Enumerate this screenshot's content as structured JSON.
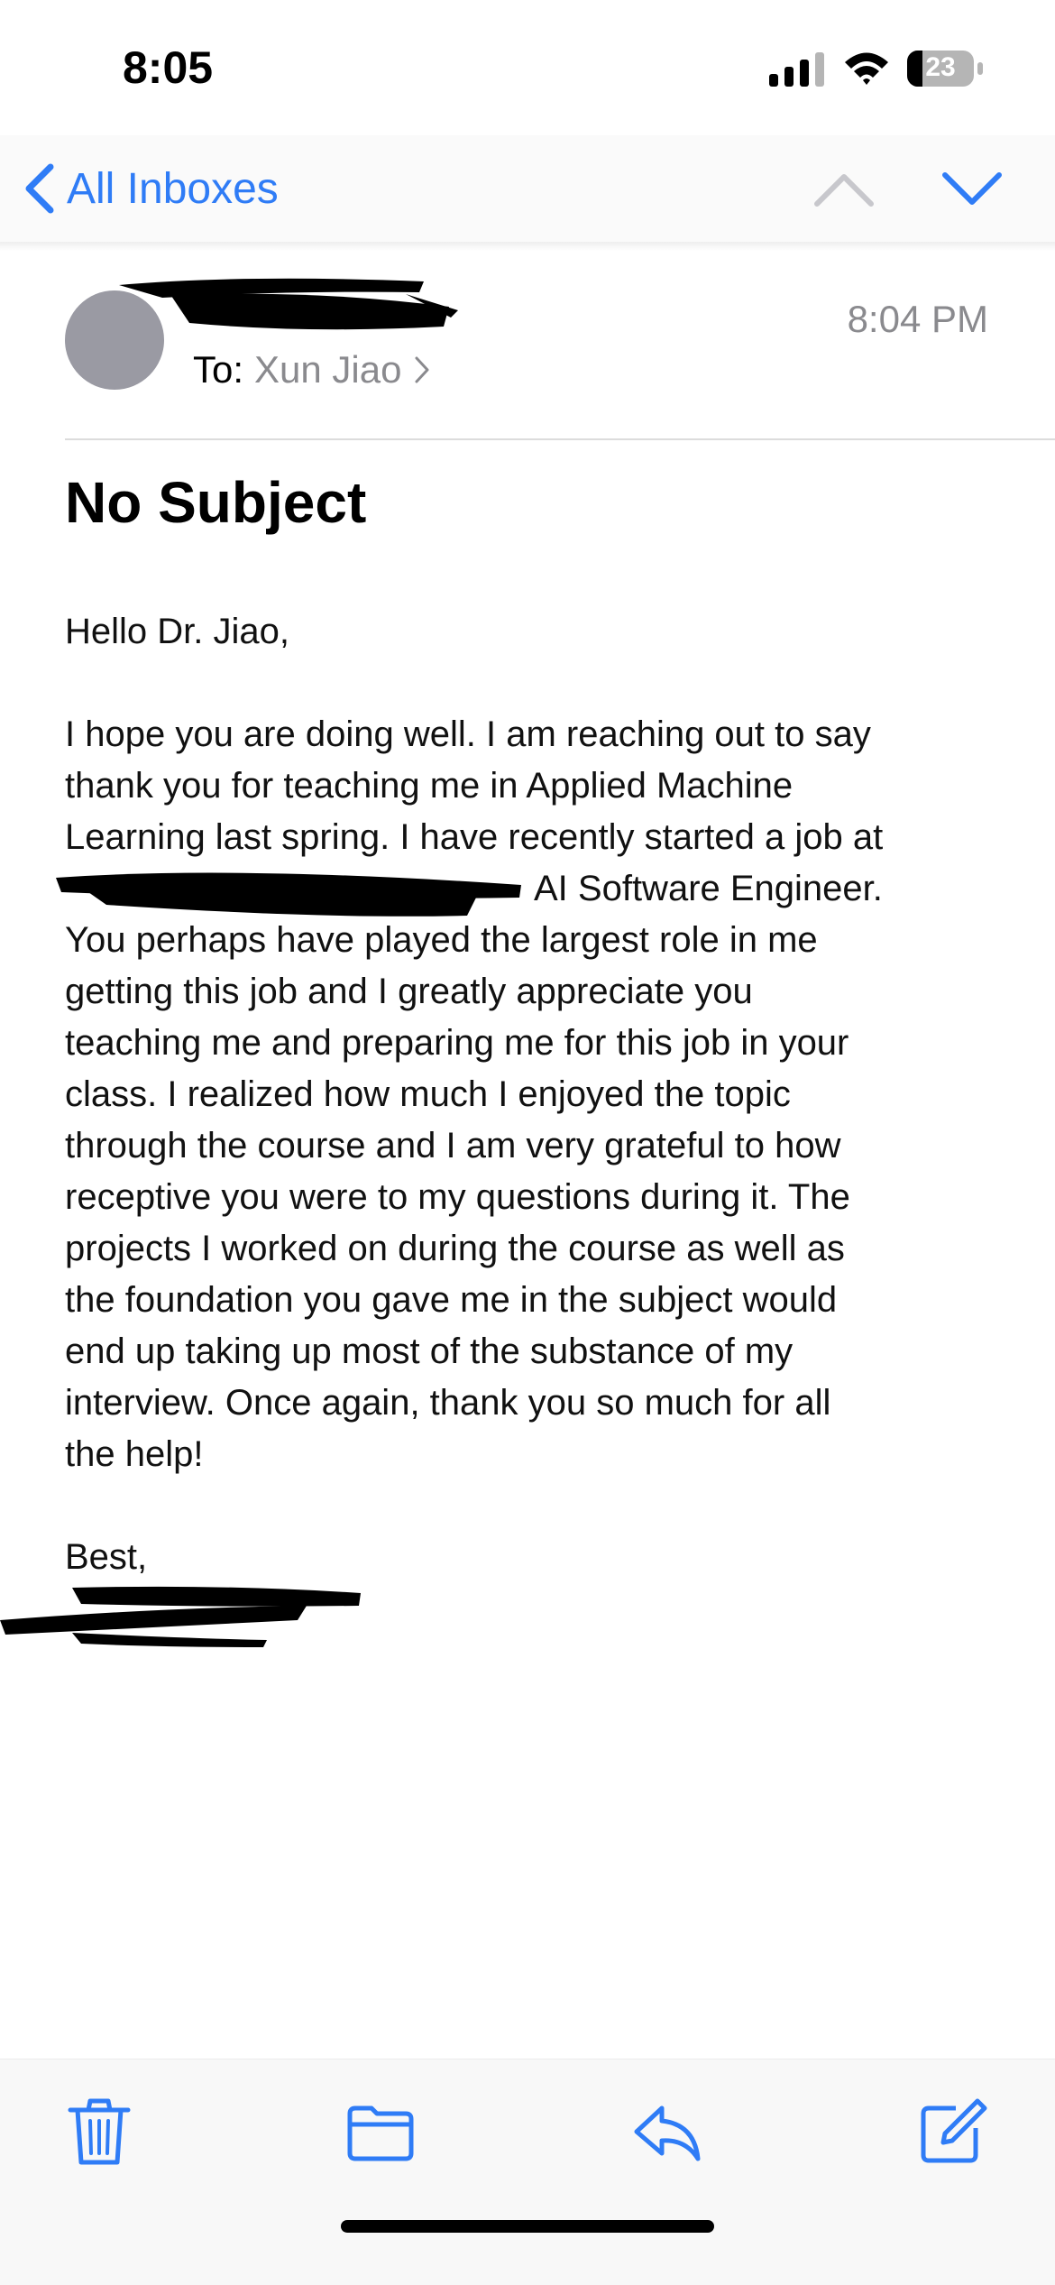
{
  "status_bar": {
    "time": "8:05",
    "battery_level": "23",
    "battery_percent": 23
  },
  "nav": {
    "back_label": "All Inboxes",
    "accent_color": "#2f7cf6",
    "prev_icon": "chevron-up-icon",
    "next_icon": "chevron-down-icon"
  },
  "header": {
    "timestamp": "8:04 PM",
    "to_label": "To:",
    "recipient": "Xun Jiao"
  },
  "message": {
    "subject": "No Subject",
    "greeting": "Hello Dr. Jiao,",
    "body_lines": [
      "I hope you are doing well. I am reaching out to say",
      "thank you for teaching me in Applied Machine",
      "Learning last spring. I have recently started a job at",
      "AI Software Engineer.",
      "You perhaps have played the largest role in me",
      "getting this job and I greatly appreciate you",
      "teaching me and preparing me for this job in your",
      "class. I realized how much I enjoyed the topic",
      "through the course and I am very grateful to how",
      "receptive you were to my questions during it. The",
      "projects I worked on during the course as well as",
      "the foundation you gave me in the subject would",
      "end up taking up most of the substance of my",
      "interview. Once again, thank you so much for all",
      "the help!"
    ],
    "closing": "Best,"
  },
  "toolbar": {
    "icons": [
      "trash-icon",
      "folder-icon",
      "reply-icon",
      "compose-icon"
    ]
  }
}
